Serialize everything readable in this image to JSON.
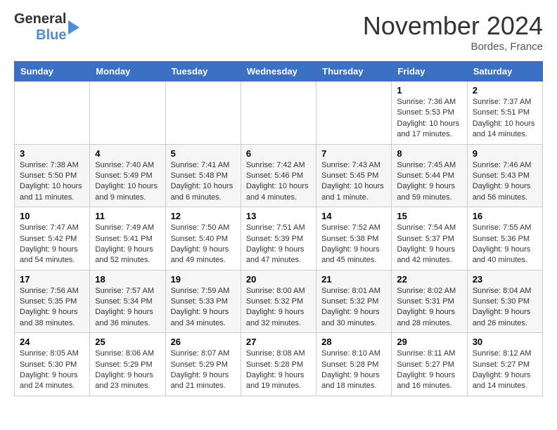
{
  "header": {
    "logo_line1": "General",
    "logo_line2": "Blue",
    "month": "November 2024",
    "location": "Bordes, France"
  },
  "columns": [
    "Sunday",
    "Monday",
    "Tuesday",
    "Wednesday",
    "Thursday",
    "Friday",
    "Saturday"
  ],
  "weeks": [
    [
      {
        "day": "",
        "info": ""
      },
      {
        "day": "",
        "info": ""
      },
      {
        "day": "",
        "info": ""
      },
      {
        "day": "",
        "info": ""
      },
      {
        "day": "",
        "info": ""
      },
      {
        "day": "1",
        "info": "Sunrise: 7:36 AM\nSunset: 5:53 PM\nDaylight: 10 hours and 17 minutes."
      },
      {
        "day": "2",
        "info": "Sunrise: 7:37 AM\nSunset: 5:51 PM\nDaylight: 10 hours and 14 minutes."
      }
    ],
    [
      {
        "day": "3",
        "info": "Sunrise: 7:38 AM\nSunset: 5:50 PM\nDaylight: 10 hours and 11 minutes."
      },
      {
        "day": "4",
        "info": "Sunrise: 7:40 AM\nSunset: 5:49 PM\nDaylight: 10 hours and 9 minutes."
      },
      {
        "day": "5",
        "info": "Sunrise: 7:41 AM\nSunset: 5:48 PM\nDaylight: 10 hours and 6 minutes."
      },
      {
        "day": "6",
        "info": "Sunrise: 7:42 AM\nSunset: 5:46 PM\nDaylight: 10 hours and 4 minutes."
      },
      {
        "day": "7",
        "info": "Sunrise: 7:43 AM\nSunset: 5:45 PM\nDaylight: 10 hours and 1 minute."
      },
      {
        "day": "8",
        "info": "Sunrise: 7:45 AM\nSunset: 5:44 PM\nDaylight: 9 hours and 59 minutes."
      },
      {
        "day": "9",
        "info": "Sunrise: 7:46 AM\nSunset: 5:43 PM\nDaylight: 9 hours and 56 minutes."
      }
    ],
    [
      {
        "day": "10",
        "info": "Sunrise: 7:47 AM\nSunset: 5:42 PM\nDaylight: 9 hours and 54 minutes."
      },
      {
        "day": "11",
        "info": "Sunrise: 7:49 AM\nSunset: 5:41 PM\nDaylight: 9 hours and 52 minutes."
      },
      {
        "day": "12",
        "info": "Sunrise: 7:50 AM\nSunset: 5:40 PM\nDaylight: 9 hours and 49 minutes."
      },
      {
        "day": "13",
        "info": "Sunrise: 7:51 AM\nSunset: 5:39 PM\nDaylight: 9 hours and 47 minutes."
      },
      {
        "day": "14",
        "info": "Sunrise: 7:52 AM\nSunset: 5:38 PM\nDaylight: 9 hours and 45 minutes."
      },
      {
        "day": "15",
        "info": "Sunrise: 7:54 AM\nSunset: 5:37 PM\nDaylight: 9 hours and 42 minutes."
      },
      {
        "day": "16",
        "info": "Sunrise: 7:55 AM\nSunset: 5:36 PM\nDaylight: 9 hours and 40 minutes."
      }
    ],
    [
      {
        "day": "17",
        "info": "Sunrise: 7:56 AM\nSunset: 5:35 PM\nDaylight: 9 hours and 38 minutes."
      },
      {
        "day": "18",
        "info": "Sunrise: 7:57 AM\nSunset: 5:34 PM\nDaylight: 9 hours and 36 minutes."
      },
      {
        "day": "19",
        "info": "Sunrise: 7:59 AM\nSunset: 5:33 PM\nDaylight: 9 hours and 34 minutes."
      },
      {
        "day": "20",
        "info": "Sunrise: 8:00 AM\nSunset: 5:32 PM\nDaylight: 9 hours and 32 minutes."
      },
      {
        "day": "21",
        "info": "Sunrise: 8:01 AM\nSunset: 5:32 PM\nDaylight: 9 hours and 30 minutes."
      },
      {
        "day": "22",
        "info": "Sunrise: 8:02 AM\nSunset: 5:31 PM\nDaylight: 9 hours and 28 minutes."
      },
      {
        "day": "23",
        "info": "Sunrise: 8:04 AM\nSunset: 5:30 PM\nDaylight: 9 hours and 26 minutes."
      }
    ],
    [
      {
        "day": "24",
        "info": "Sunrise: 8:05 AM\nSunset: 5:30 PM\nDaylight: 9 hours and 24 minutes."
      },
      {
        "day": "25",
        "info": "Sunrise: 8:06 AM\nSunset: 5:29 PM\nDaylight: 9 hours and 23 minutes."
      },
      {
        "day": "26",
        "info": "Sunrise: 8:07 AM\nSunset: 5:29 PM\nDaylight: 9 hours and 21 minutes."
      },
      {
        "day": "27",
        "info": "Sunrise: 8:08 AM\nSunset: 5:28 PM\nDaylight: 9 hours and 19 minutes."
      },
      {
        "day": "28",
        "info": "Sunrise: 8:10 AM\nSunset: 5:28 PM\nDaylight: 9 hours and 18 minutes."
      },
      {
        "day": "29",
        "info": "Sunrise: 8:11 AM\nSunset: 5:27 PM\nDaylight: 9 hours and 16 minutes."
      },
      {
        "day": "30",
        "info": "Sunrise: 8:12 AM\nSunset: 5:27 PM\nDaylight: 9 hours and 14 minutes."
      }
    ]
  ]
}
